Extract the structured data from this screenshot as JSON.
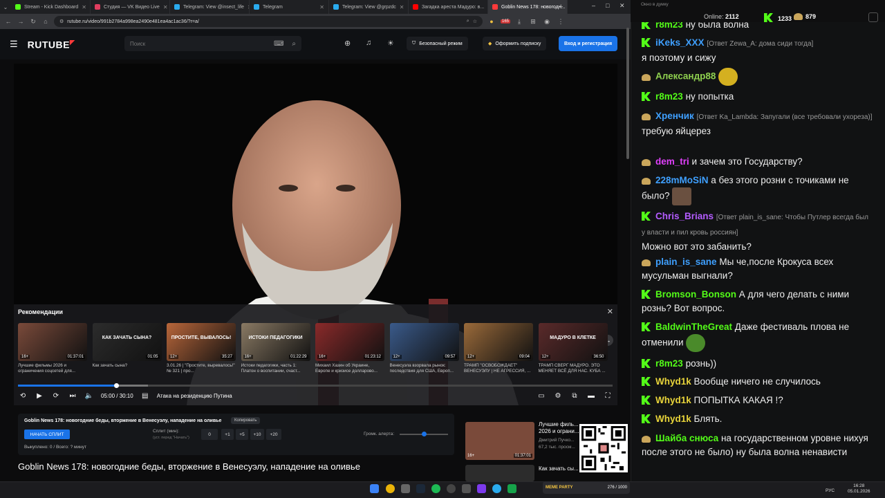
{
  "browser": {
    "tabs": [
      {
        "label": "Stream - Kick Dashboard",
        "color": "#53fc18"
      },
      {
        "label": "Студия — VK Видео Live",
        "color": "#e03d5f"
      },
      {
        "label": "Telegram: View @insect_life",
        "color": "#2aabee"
      },
      {
        "label": "Telegram",
        "color": "#2aabee"
      },
      {
        "label": "Telegram: View @grpzdc",
        "color": "#2aabee"
      },
      {
        "label": "Загадка ареста Мадуро: в...",
        "color": "#ff0000"
      },
      {
        "label": "Goblin News 178: новогодн...",
        "color": "#ff3a3a"
      }
    ],
    "url": "rutube.ru/video/991b2784a998ea2490e481ea4ac1ac36/?r=a/",
    "ext_badge": "165"
  },
  "rutube": {
    "logo": "RUTUBE",
    "search_placeholder": "Поиск",
    "safe_mode": "Безопасный режим",
    "subscribe": "Оформить подписку",
    "login": "Вход и регистрация"
  },
  "recommendations": {
    "title": "Рекомендации",
    "items": [
      {
        "age": "16+",
        "duration": "01:37:01",
        "caption": "Лучшие фильмы 2026 и ограничения соцсетей для...",
        "color": "#7a4a3a"
      },
      {
        "age": "",
        "duration": "01:05",
        "caption": "Как зачать сына?",
        "color": "#2c2c2c",
        "overlay": "КАК ЗАЧАТЬ СЫНА?"
      },
      {
        "age": "12+",
        "duration": "35:27",
        "caption": "3.01.26 | \"Простите, выревалось!\" № 321 | про...",
        "color": "#b8663a",
        "overlay": "ПРОСТИТЕ, ВЫВАЛОСЬ!"
      },
      {
        "age": "16+",
        "duration": "01:22:29",
        "caption": "Истоки педагогики, часть 1: Платон о воспитании, счаст...",
        "color": "#8a7a64",
        "overlay": "ИСТОКИ ПЕДАГОГИКИ"
      },
      {
        "age": "16+",
        "duration": "01:23:12",
        "caption": "Михаил Хазин об Украине, Европе и кризисе долларово...",
        "color": "#8a2a2a"
      },
      {
        "age": "12+",
        "duration": "09:57",
        "caption": "Венесуэла взорвала рынок: последствия для США, Европ...",
        "color": "#3a5a8a"
      },
      {
        "age": "12+",
        "duration": "09:04",
        "caption": "ТРАМП \"ОСВОБОЖДАЕТ\" ВЕНЕСУЭЛУ | НЕ АГРЕССИЯ, ...",
        "color": "#9a6a3a"
      },
      {
        "age": "12+",
        "duration": "36:50",
        "caption": "ТРАМП СВЕРГ МАДУРО. ЭТО МЕНЯЕТ ВСЁ ДЛЯ НАС. КУБА ...",
        "color": "#5a2a2a",
        "overlay": "МАДУРО В КЛЕТКЕ"
      }
    ]
  },
  "player": {
    "time": "05:00 / 30:10",
    "chapter": "Атака на резиденцию Путина",
    "progress": 0.166
  },
  "split": {
    "title": "Goblin News 178: новогодние беды, вторжение в Венесуэлу, нападение на оливье",
    "copy": "Копировать",
    "start": "НАЧАТЬ СПЛИТ",
    "label": "Сплит (мин):",
    "sub": "(уст. перед \"Начать\")",
    "value": "0",
    "buttons": [
      "+1",
      "+5",
      "+10",
      "+20"
    ],
    "alert_label": "Громк. алерта:",
    "alert_volume": 0.5,
    "stats": "Выкуплено: 0 / Всего: ? минут"
  },
  "page_title": "Goblin News 178: новогодние беды, вторжение в Венесуэлу, нападение на оливье",
  "side_recs": [
    {
      "title": "Лучшие филь... 2026 и ограни...",
      "meta": "Дмитрий Пучко...",
      "meta2": "67,2 тыс. просм...",
      "age": "16+",
      "duration": "01:37:01"
    },
    {
      "title": "Как зачать сы...",
      "meta": "",
      "meta2": "",
      "age": "",
      "duration": ""
    }
  ],
  "chat_header": {
    "window_title": "Окно в думку",
    "online_label": "Online:",
    "online": "2112",
    "kick": "1233",
    "vk": "879"
  },
  "chat": [
    {
      "badge": "k",
      "nick": "r8m23",
      "nick_color": "#53fc18",
      "reply": "",
      "text": "ну была волна"
    },
    {
      "badge": "k",
      "nick": "iKeks_XXX",
      "nick_color": "#3fa0ff",
      "reply": "[Ответ Zewa_A: дома сиди тогда]",
      "text": "я поэтому и сижу"
    },
    {
      "badge": "hat",
      "nick": "Александр88",
      "nick_color": "#8fd14f",
      "reply": "",
      "text": ""
    },
    {
      "badge": "k",
      "nick": "r8m23",
      "nick_color": "#53fc18",
      "reply": "",
      "text": "ну попытка"
    },
    {
      "badge": "hat",
      "nick": "Хренчик",
      "nick_color": "#3fa0ff",
      "reply": "[Ответ Ka_Lambda: Запугали (все требовали ухореза)]",
      "text": "требую яйцерез"
    },
    {
      "badge": "hat",
      "nick": "dem_tri",
      "nick_color": "#e040fb",
      "reply": "",
      "text": "и зачем это Государству?"
    },
    {
      "badge": "hat",
      "nick": "228mMoSiN",
      "nick_color": "#3fa0ff",
      "reply": "",
      "text": "а без этого розни с точиками не было?"
    },
    {
      "badge": "k",
      "nick": "Chris_Brians",
      "nick_color": "#b45cff",
      "reply": "[Ответ plain_is_sane: Чтобы Путлер всегда был у власти и пил кровь россиян]",
      "text": "Можно вот это забанить?"
    },
    {
      "badge": "hat",
      "nick": "plain_is_sane",
      "nick_color": "#3fa0ff",
      "reply": "",
      "text": "Мы че,после Крокуса всех мусульман выгнали?"
    },
    {
      "badge": "k",
      "nick": "Bromson_Bonson",
      "nick_color": "#53fc18",
      "reply": "",
      "text": "А для чего делать с ними рознь? Вот вопрос."
    },
    {
      "badge": "k",
      "nick": "BaldwinTheGreat",
      "nick_color": "#53fc18",
      "reply": "",
      "text": "Даже фестиваль плова не отменили"
    },
    {
      "badge": "k",
      "nick": "r8m23",
      "nick_color": "#53fc18",
      "reply": "",
      "text": "рознь))"
    },
    {
      "badge": "k",
      "nick": "Whyd1k",
      "nick_color": "#e8d43a",
      "reply": "",
      "text": "Вообще ничего не случилось"
    },
    {
      "badge": "k",
      "nick": "Whyd1k",
      "nick_color": "#e8d43a",
      "reply": "",
      "text": "ПОПЫТКА КАКАЯ !?"
    },
    {
      "badge": "k",
      "nick": "Whyd1k",
      "nick_color": "#e8d43a",
      "reply": "",
      "text": "Блять."
    },
    {
      "badge": "hat",
      "nick": "Шайба снюса",
      "nick_color": "#53fc18",
      "reply": "",
      "text": "на государственном уровне нихуя после этого не было) ну была волна ненависти"
    }
  ],
  "taskbar": {
    "meme_label": "MEME PARTY",
    "meme_count": "276 / 1000",
    "lang": "РУС",
    "time": "16:28",
    "date": "05.01.2026"
  }
}
